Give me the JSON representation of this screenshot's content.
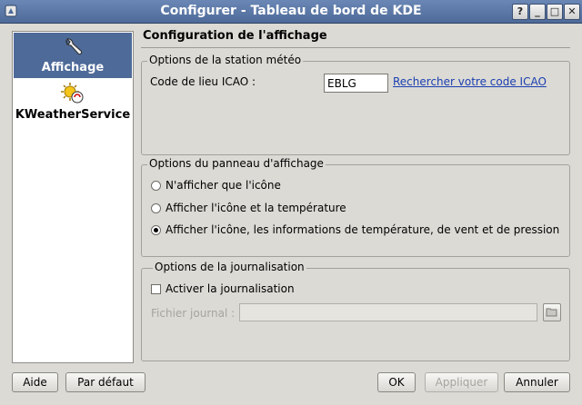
{
  "window": {
    "title": "Configurer - Tableau de bord de KDE",
    "controls": [
      "?",
      "_",
      "□",
      "✕"
    ]
  },
  "sidebar": {
    "items": [
      {
        "label": "Affichage",
        "icon": "wrench-icon",
        "selected": true
      },
      {
        "label": "KWeatherService",
        "icon": "weather-service-icon",
        "selected": false
      }
    ]
  },
  "page": {
    "title": "Configuration de l'affichage"
  },
  "station": {
    "group_label": "Options de la station météo",
    "icao_label": "Code de lieu ICAO :",
    "icao_value": "EBLG",
    "search_link": "Rechercher votre code ICAO"
  },
  "panel": {
    "group_label": "Options du panneau d'affichage",
    "options": [
      {
        "label": "N'afficher que l'icône",
        "checked": false
      },
      {
        "label": "Afficher l'icône et la température",
        "checked": false
      },
      {
        "label": "Afficher l'icône, les informations de température, de vent et de pression",
        "checked": true
      }
    ]
  },
  "logging": {
    "group_label": "Options de la journalisation",
    "enable_label": "Activer la journalisation",
    "enabled": false,
    "file_label": "Fichier journal :",
    "file_value": ""
  },
  "buttons": {
    "help": "Aide",
    "defaults": "Par défaut",
    "ok": "OK",
    "apply": "Appliquer",
    "cancel": "Annuler"
  }
}
